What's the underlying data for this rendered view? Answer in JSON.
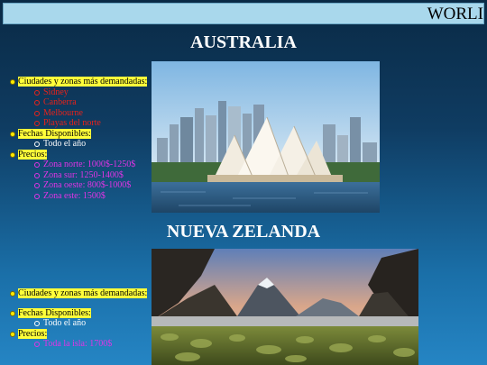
{
  "banner": {
    "text": "WORLI"
  },
  "australia": {
    "title": "AUSTRALIA",
    "zones_label": "Ciudades y zonas más demandadas:",
    "zones": [
      "Sidney",
      "Canberra",
      "Melbourne",
      "Playas del norte"
    ],
    "dates_label": "Fechas Disponibles:",
    "dates": [
      "Todo el año"
    ],
    "prices_label": "Precios:",
    "prices": [
      "Zona norte: 1000$-1250$",
      "Zona sur: 1250-1400$",
      "Zona oeste: 800$-1000$",
      "Zona este: 1500$"
    ]
  },
  "nz": {
    "title": "NUEVA ZELANDA",
    "zones_label": "Ciudades y zonas más demandadas:",
    "dates_label": "Fechas Disponibles:",
    "dates": [
      "Todo el año"
    ],
    "prices_label": "Precios:",
    "prices": [
      "Toda la isla: 1700$"
    ]
  },
  "images": {
    "sydney": "sydney-opera-house-photo",
    "nz": "milford-sound-photo"
  }
}
